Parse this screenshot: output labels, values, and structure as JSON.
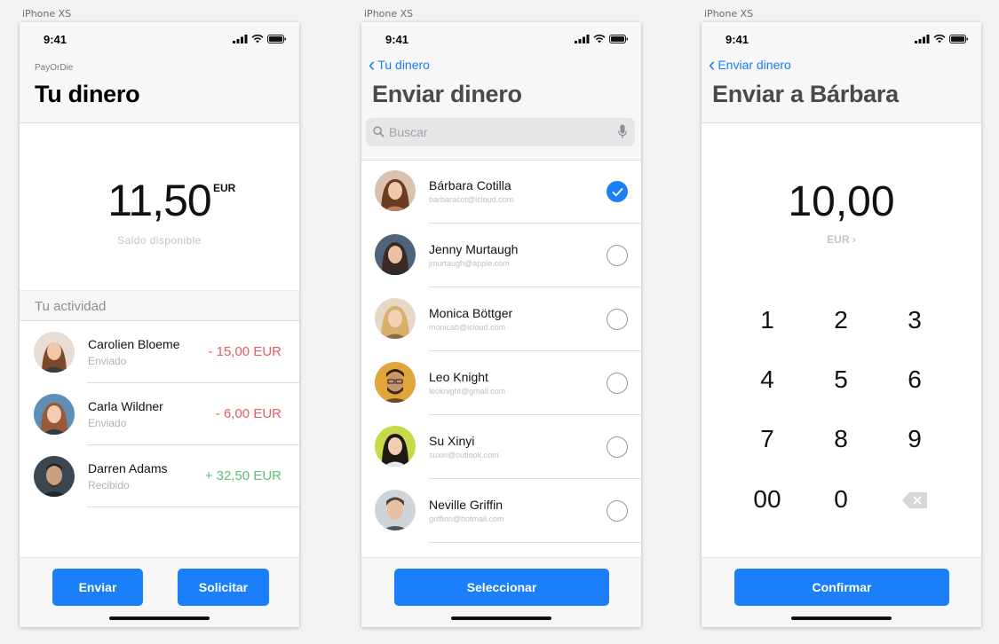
{
  "artboard_label": "iPhone XS",
  "status_time": "9:41",
  "screen1": {
    "app_name": "PayOrDie",
    "title": "Tu dinero",
    "balance": "11,50",
    "currency": "EUR",
    "balance_caption": "Saldo disponible",
    "section_title": "Tu actividad",
    "activity": [
      {
        "name": "Carolien Bloeme",
        "status": "Enviado",
        "amount": "- 15,00 EUR",
        "color": "#ec5b5b"
      },
      {
        "name": "Carla Wildner",
        "status": "Enviado",
        "amount": "- 6,00 EUR",
        "color": "#ec5b5b"
      },
      {
        "name": "Darren Adams",
        "status": "Recibido",
        "amount": "+ 32,50 EUR",
        "color": "#5cc07a"
      }
    ],
    "send_label": "Enviar",
    "request_label": "Solicitar"
  },
  "screen2": {
    "back_label": "Tu dinero",
    "title": "Enviar dinero",
    "search_placeholder": "Buscar",
    "contacts": [
      {
        "name": "Bárbara Cotilla",
        "email": "barbaracot@icloud.com",
        "selected": true
      },
      {
        "name": "Jenny Murtaugh",
        "email": "jmurtaugh@apple.com",
        "selected": false
      },
      {
        "name": "Monica Böttger",
        "email": "monicab@icloud.com",
        "selected": false
      },
      {
        "name": "Leo Knight",
        "email": "leoknight@gmail.com",
        "selected": false
      },
      {
        "name": "Su Xinyi",
        "email": "suxin@outlook.com",
        "selected": false
      },
      {
        "name": "Neville Griffin",
        "email": "griffinn@hotmail.com",
        "selected": false
      }
    ],
    "select_label": "Seleccionar"
  },
  "screen3": {
    "back_label": "Enviar dinero",
    "title": "Enviar a Bárbara",
    "amount": "10,00",
    "currency": "EUR",
    "keys": [
      "1",
      "2",
      "3",
      "4",
      "5",
      "6",
      "7",
      "8",
      "9",
      "00",
      "0"
    ],
    "confirm_label": "Confirmar"
  },
  "colors": {
    "accent": "#1a7ff8",
    "negative": "#ec5b5b",
    "positive": "#5cc07a"
  }
}
